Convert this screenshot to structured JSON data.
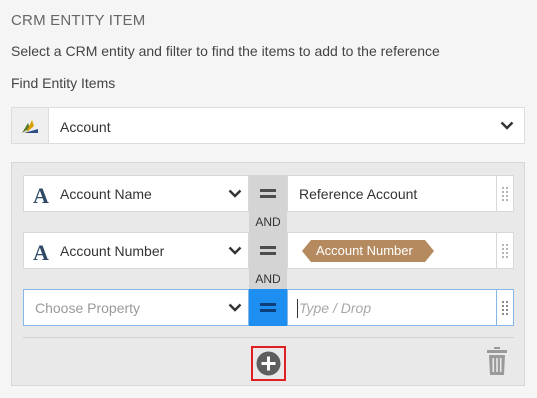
{
  "header": {
    "title": "CRM ENTITY ITEM",
    "description": "Select a CRM entity and filter to find the items to add to the reference",
    "find_label": "Find Entity Items"
  },
  "entity_select": {
    "icon": "dynamics-crm-icon",
    "value": "Account"
  },
  "filters": {
    "rows": [
      {
        "property_icon": "text-type-icon",
        "property": "Account Name",
        "operator_icon": "equals-icon",
        "value": "Reference Account"
      },
      {
        "property_icon": "text-type-icon",
        "property": "Account Number",
        "operator_icon": "equals-icon",
        "value_token": "Account Number"
      },
      {
        "property_placeholder": "Choose Property",
        "operator_icon": "equals-icon",
        "value_placeholder": "Type / Drop"
      }
    ],
    "connector": "AND",
    "connector_2": "AND"
  },
  "actions": {
    "add_icon": "plus-circle-icon",
    "delete_icon": "trash-icon"
  },
  "colors": {
    "accent": "#1e8ff0",
    "highlight_border": "#e02020",
    "token": "#b48a5e",
    "type_icon": "#2f4a66"
  }
}
